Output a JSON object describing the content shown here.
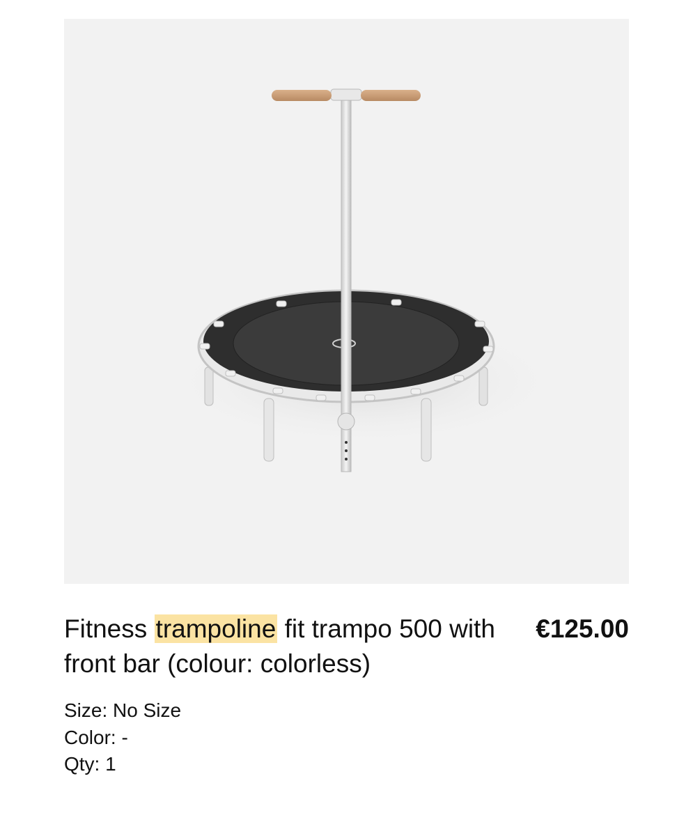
{
  "product": {
    "image_alt": "Fitness trampoline fit trampo 500 with front bar",
    "title_before": "Fitness ",
    "title_highlight": "trampoline",
    "title_after": " fit trampo 500 with front bar (colour: colorless)",
    "price": "€125.00"
  },
  "attributes": {
    "size": "Size: No Size",
    "color": "Color: -",
    "qty": "Qty: 1"
  },
  "colors": {
    "image_background": "#f2f2f2",
    "highlight": "#fbe3a3",
    "text": "#111111"
  }
}
